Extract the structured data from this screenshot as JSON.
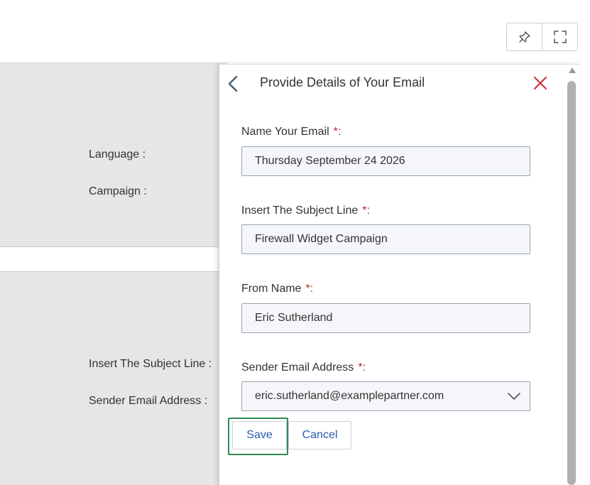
{
  "toolbar": {
    "pin_icon": "pin-icon",
    "fullscreen_icon": "fullscreen-icon"
  },
  "background_form": {
    "top_labels": [
      "Language :",
      "Campaign :"
    ],
    "bottom_labels": [
      "Insert The Subject Line :",
      "Sender Email Address :"
    ]
  },
  "drawer": {
    "title": "Provide Details of Your Email",
    "back_icon": "chevron-left-icon",
    "close_icon": "close-icon",
    "close_color": "#d13438",
    "fields": [
      {
        "label": "Name Your Email",
        "required_mark": "*:",
        "value": "Thursday September 24 2026"
      },
      {
        "label": "Insert The Subject Line",
        "required_mark": "*:",
        "value": "Firewall Widget Campaign"
      },
      {
        "label": "From Name",
        "required_mark": "*:",
        "value": "Eric Sutherland"
      }
    ],
    "sender": {
      "label": "Sender Email Address",
      "required_mark": "*:",
      "value": "eric.sutherland@examplepartner.com",
      "dropdown_icon": "chevron-down-icon"
    },
    "save_label": "Save",
    "cancel_label": "Cancel",
    "focus_color": "#2e8b57"
  }
}
